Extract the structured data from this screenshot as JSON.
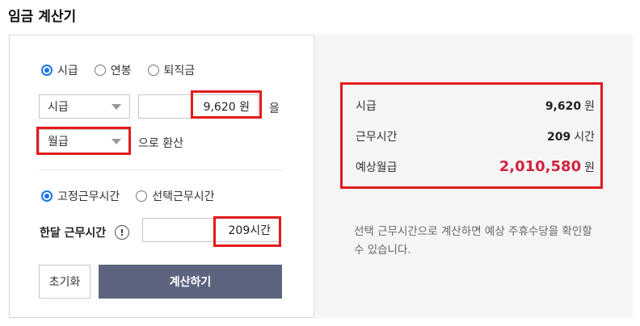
{
  "title": "임금 계산기",
  "pay_type_radios": [
    {
      "label": "시급",
      "selected": true
    },
    {
      "label": "연봉",
      "selected": false
    },
    {
      "label": "퇴직금",
      "selected": false
    }
  ],
  "from_unit": {
    "value": "시급"
  },
  "wage_input": {
    "value": "9,620 원"
  },
  "object_particle": "을",
  "to_unit": {
    "value": "월급"
  },
  "convert_suffix": "으로 환산",
  "work_type_radios": [
    {
      "label": "고정근무시간",
      "selected": true
    },
    {
      "label": "선택근무시간",
      "selected": false
    }
  ],
  "monthly_hours": {
    "label": "한달 근무시간",
    "help": "!",
    "value": "209시간"
  },
  "buttons": {
    "reset": "초기화",
    "calculate": "계산하기"
  },
  "results": [
    {
      "label": "시급",
      "value": "9,620",
      "unit": "원"
    },
    {
      "label": "근무시간",
      "value": "209",
      "unit": "시간"
    },
    {
      "label": "예상월급",
      "value": "2,010,580",
      "unit": "원"
    }
  ],
  "note": "선택 근무시간으로 계산하면 예상 주휴수당을 확인할 수 있습니다.",
  "colors": {
    "highlight": "#e21b1b",
    "accent": "#1a73e8",
    "button": "#5d6480",
    "total": "#d0243e"
  }
}
